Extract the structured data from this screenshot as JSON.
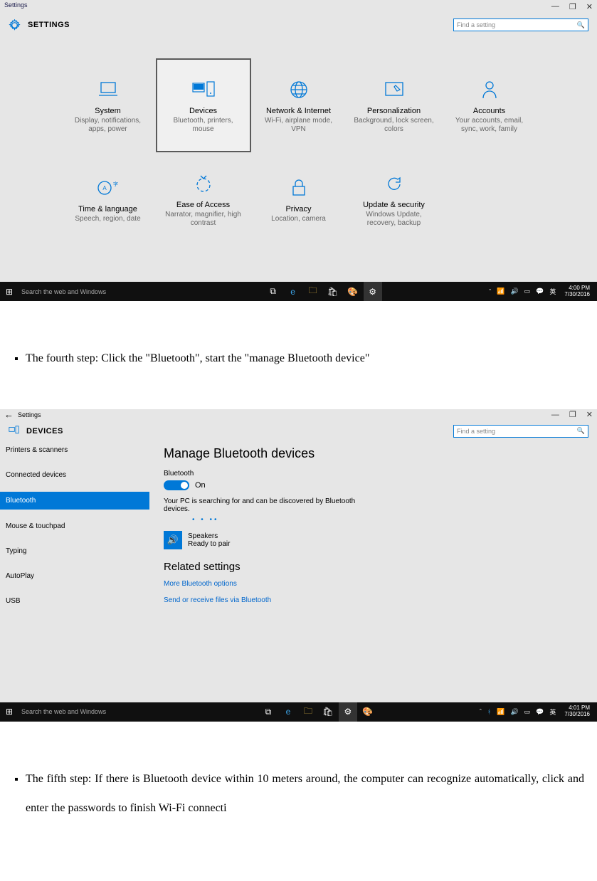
{
  "shot1": {
    "titlebar": "Settings",
    "header_title": "SETTINGS",
    "search_placeholder": "Find a setting",
    "tiles": [
      {
        "title": "System",
        "sub": "Display, notifications, apps, power"
      },
      {
        "title": "Devices",
        "sub": "Bluetooth, printers, mouse"
      },
      {
        "title": "Network & Internet",
        "sub": "Wi-Fi, airplane mode, VPN"
      },
      {
        "title": "Personalization",
        "sub": "Background, lock screen, colors"
      },
      {
        "title": "Accounts",
        "sub": "Your accounts, email, sync, work, family"
      },
      {
        "title": "Time & language",
        "sub": "Speech, region, date"
      },
      {
        "title": "Ease of Access",
        "sub": "Narrator, magnifier, high contrast"
      },
      {
        "title": "Privacy",
        "sub": "Location, camera"
      },
      {
        "title": "Update & security",
        "sub": "Windows Update, recovery, backup"
      }
    ],
    "taskbar": {
      "search": "Search the web and Windows",
      "ime": "英",
      "time": "4:00 PM",
      "date": "7/30/2016"
    }
  },
  "doc": {
    "step4": "The fourth step: Click the \"Bluetooth\", start the \"manage Bluetooth device\"",
    "step5": "The fifth step: If there is Bluetooth device within 10 meters around, the computer can recognize automatically, click and enter the passwords to finish Wi-Fi connecti"
  },
  "shot2": {
    "titlebar": "Settings",
    "header_title": "DEVICES",
    "search_placeholder": "Find a setting",
    "sidebar": [
      "Printers & scanners",
      "Connected devices",
      "Bluetooth",
      "Mouse & touchpad",
      "Typing",
      "AutoPlay",
      "USB"
    ],
    "main": {
      "heading": "Manage Bluetooth devices",
      "bt_label": "Bluetooth",
      "bt_state": "On",
      "searching": "Your PC is searching for and can be discovered by Bluetooth devices.",
      "device_name": "Speakers",
      "device_status": "Ready to pair",
      "related_heading": "Related settings",
      "link1": "More Bluetooth options",
      "link2": "Send or receive files via Bluetooth"
    },
    "taskbar": {
      "search": "Search the web and Windows",
      "ime": "英",
      "time": "4:01 PM",
      "date": "7/30/2016"
    }
  }
}
